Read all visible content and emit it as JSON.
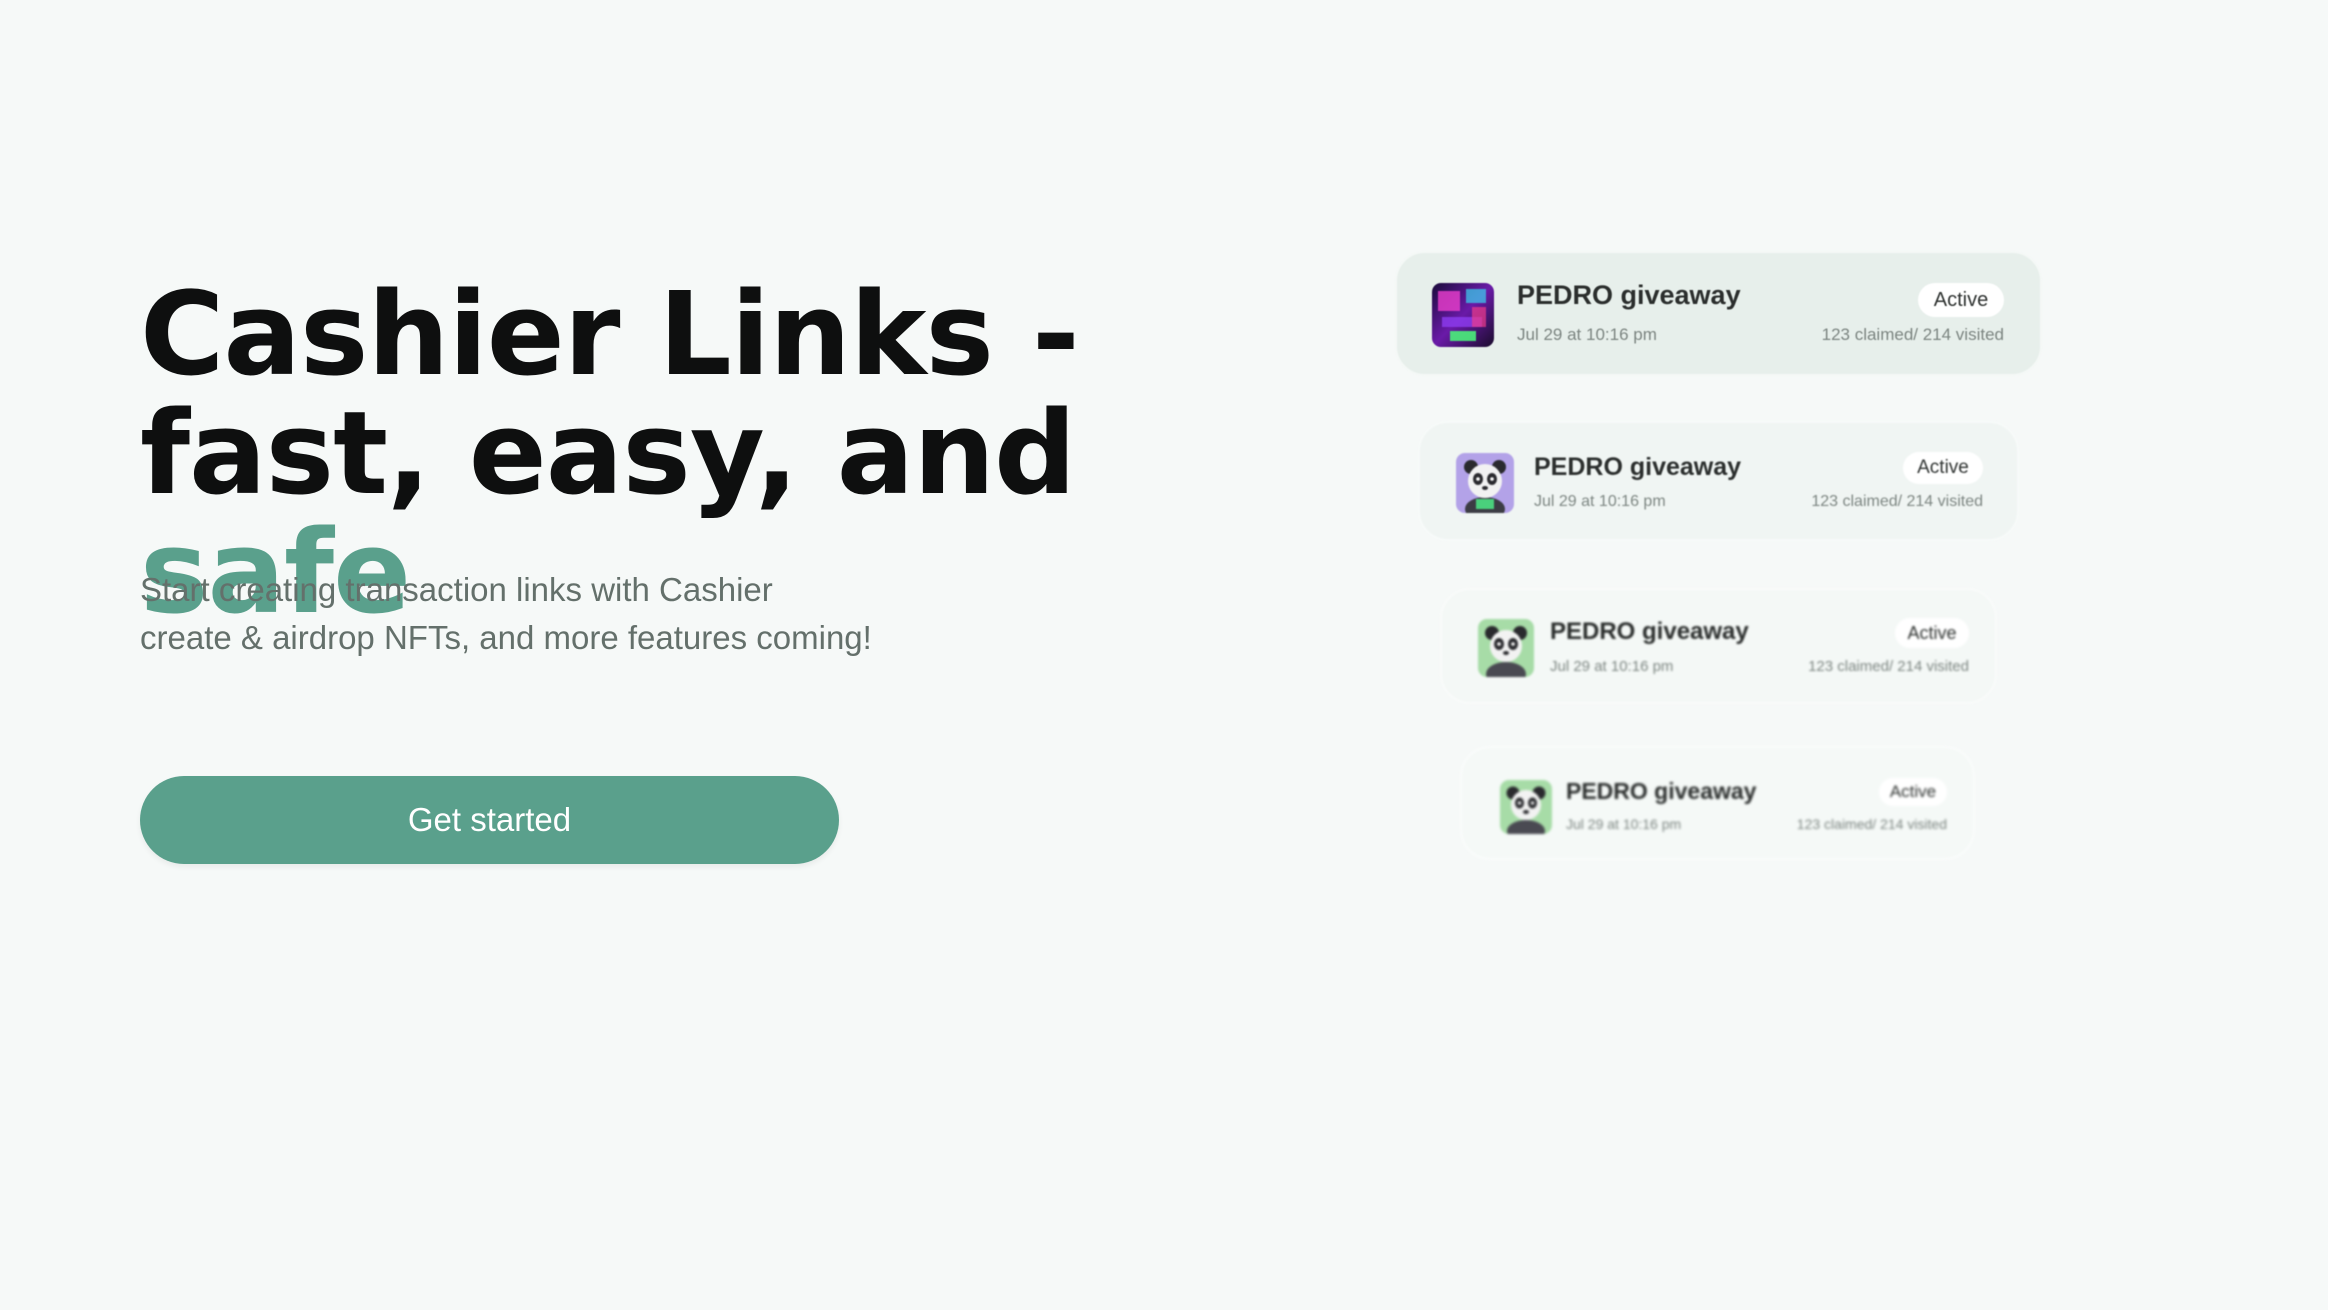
{
  "hero": {
    "headline_line1": "Cashier Links -",
    "headline_line2_prefix": "fast, easy, and ",
    "headline_accent": "safe",
    "subtitle_line1": "Start creating transaction links with Cashier",
    "subtitle_line2": "create & airdrop NFTs, and more features coming!",
    "cta_label": "Get started"
  },
  "cards": [
    {
      "title": "PEDRO giveaway",
      "date": "Jul 29 at 10:16 pm",
      "status": "Active",
      "stats": "123 claimed/ 214 visited",
      "thumb_icon": "neon-room-art-icon"
    },
    {
      "title": "PEDRO giveaway",
      "date": "Jul 29 at 10:16 pm",
      "status": "Active",
      "stats": "123 claimed/ 214 visited",
      "thumb_icon": "panda-avatar-icon"
    },
    {
      "title": "PEDRO giveaway",
      "date": "Jul 29 at 10:16 pm",
      "status": "Active",
      "stats": "123 claimed/ 214 visited",
      "thumb_icon": "panda-avatar-icon"
    },
    {
      "title": "PEDRO giveaway",
      "date": "Jul 29 at 10:16 pm",
      "status": "Active",
      "stats": "123 claimed/ 214 visited",
      "thumb_icon": "panda-avatar-icon"
    }
  ],
  "colors": {
    "accent": "#5aa08c",
    "background": "#f6f9f8",
    "headline": "#0e0f0f",
    "subtitle": "#64706b"
  }
}
